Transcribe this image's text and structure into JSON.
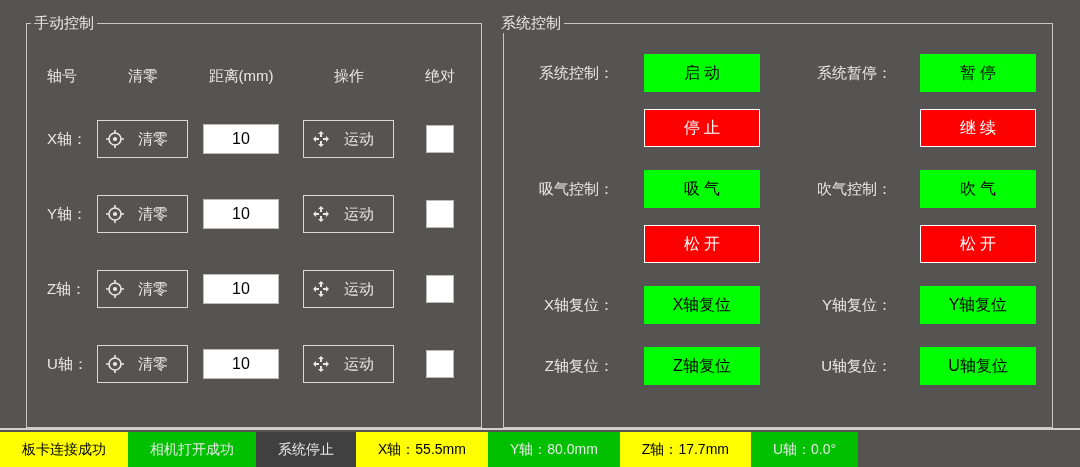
{
  "manual_control": {
    "title": "手动控制",
    "columns": [
      "轴号",
      "清零",
      "距离(mm)",
      "操作",
      "绝对"
    ],
    "axes": [
      {
        "label": "X轴：",
        "clear_button": "清零",
        "distance": "10",
        "move_button": "运动",
        "absolute": {
          "checked": false
        }
      },
      {
        "label": "Y轴：",
        "clear_button": "清零",
        "distance": "10",
        "move_button": "运动",
        "absolute": {
          "checked": false
        }
      },
      {
        "label": "Z轴：",
        "clear_button": "清零",
        "distance": "10",
        "move_button": "运动",
        "absolute": {
          "checked": false
        }
      },
      {
        "label": "U轴：",
        "clear_button": "清零",
        "distance": "10",
        "move_button": "运动",
        "absolute": {
          "checked": false
        }
      }
    ]
  },
  "system_control": {
    "title": "系统控制",
    "controls": [
      {
        "label": "系统控制：",
        "buttons": [
          {
            "text": "启 动",
            "color": "#00ff00"
          },
          {
            "text": "停 止",
            "color": "#ff0000"
          }
        ]
      },
      {
        "label": "系统暂停：",
        "buttons": [
          {
            "text": "暂 停",
            "color": "#00ff00"
          },
          {
            "text": "继 续",
            "color": "#ff0000"
          }
        ]
      },
      {
        "label": "吸气控制：",
        "buttons": [
          {
            "text": "吸 气",
            "color": "#00ff00"
          },
          {
            "text": "松 开",
            "color": "#ff0000"
          }
        ]
      },
      {
        "label": "吹气控制：",
        "buttons": [
          {
            "text": "吹 气",
            "color": "#00ff00"
          },
          {
            "text": "松 开",
            "color": "#ff0000"
          }
        ]
      },
      {
        "label": "X轴复位：",
        "buttons": [
          {
            "text": "X轴复位",
            "color": "#00ff00"
          }
        ]
      },
      {
        "label": "Y轴复位：",
        "buttons": [
          {
            "text": "Y轴复位",
            "color": "#00ff00"
          }
        ]
      },
      {
        "label": "Z轴复位：",
        "buttons": [
          {
            "text": "Z轴复位",
            "color": "#00ff00"
          }
        ]
      },
      {
        "label": "U轴复位：",
        "buttons": [
          {
            "text": "U轴复位",
            "color": "#00ff00"
          }
        ]
      }
    ]
  },
  "status_bar": [
    {
      "text": "板卡连接成功",
      "color": "#ffff00"
    },
    {
      "text": "相机打开成功",
      "color": "#00c000"
    },
    {
      "text": "系统停止",
      "color": "#404040"
    },
    {
      "text": "X轴：55.5mm",
      "color": "#ffff00"
    },
    {
      "text": "Y轴：80.0mm",
      "color": "#00c000"
    },
    {
      "text": "Z轴：17.7mm",
      "color": "#ffff00"
    },
    {
      "text": "U轴：0.0°",
      "color": "#00c000"
    }
  ]
}
